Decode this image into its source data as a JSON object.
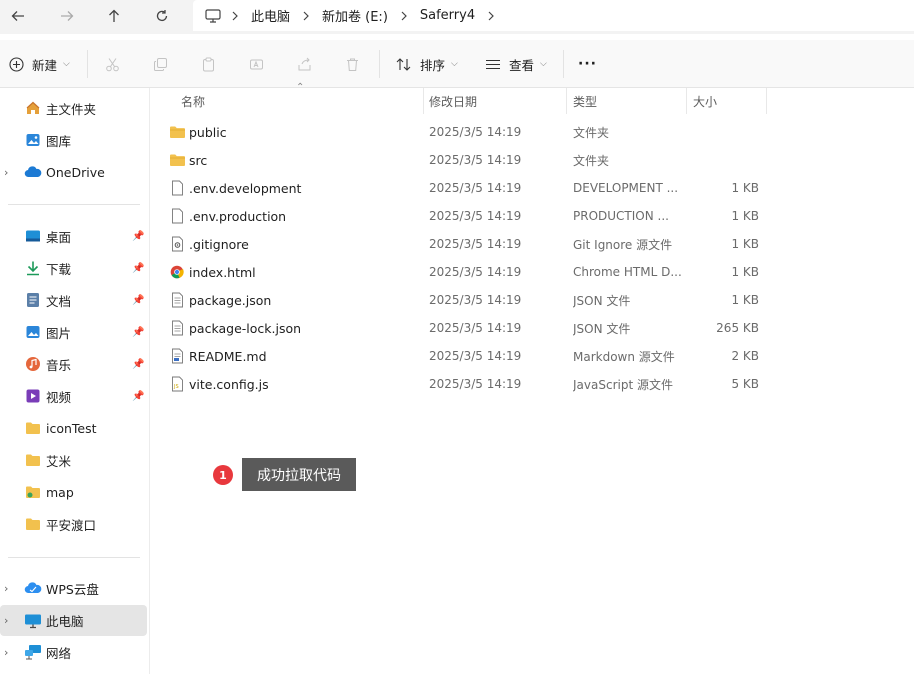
{
  "address": {
    "crumbs": [
      "此电脑",
      "新加卷 (E:)",
      "Saferry4"
    ]
  },
  "toolbar": {
    "new_label": "新建",
    "sort_label": "排序",
    "view_label": "查看",
    "more_label": "···"
  },
  "sidebar": {
    "top": [
      {
        "label": "主文件夹",
        "icon": "home-icon"
      },
      {
        "label": "图库",
        "icon": "gallery-icon"
      },
      {
        "label": "OneDrive",
        "icon": "onedrive-icon"
      }
    ],
    "quick": [
      {
        "label": "桌面",
        "icon": "desktop-icon"
      },
      {
        "label": "下载",
        "icon": "download-icon"
      },
      {
        "label": "文档",
        "icon": "documents-icon"
      },
      {
        "label": "图片",
        "icon": "pictures-icon"
      },
      {
        "label": "音乐",
        "icon": "music-icon"
      },
      {
        "label": "视频",
        "icon": "video-icon"
      },
      {
        "label": "iconTest",
        "icon": "folder-icon"
      },
      {
        "label": "艾米",
        "icon": "folder-icon"
      },
      {
        "label": "map",
        "icon": "folder-icon"
      },
      {
        "label": "平安渡口",
        "icon": "folder-icon"
      }
    ],
    "bottom": [
      {
        "label": "WPS云盘",
        "icon": "wps-cloud-icon"
      },
      {
        "label": "此电脑",
        "icon": "this-pc-icon"
      },
      {
        "label": "网络",
        "icon": "network-icon"
      }
    ]
  },
  "columns": {
    "name": "名称",
    "date": "修改日期",
    "type": "类型",
    "size": "大小"
  },
  "files": [
    {
      "name": "public",
      "date": "2025/3/5 14:19",
      "type": "文件夹",
      "size": "",
      "icon": "folder-icon"
    },
    {
      "name": "src",
      "date": "2025/3/5 14:19",
      "type": "文件夹",
      "size": "",
      "icon": "folder-icon"
    },
    {
      "name": ".env.development",
      "date": "2025/3/5 14:19",
      "type": "DEVELOPMENT ...",
      "size": "1 KB",
      "icon": "file-icon"
    },
    {
      "name": ".env.production",
      "date": "2025/3/5 14:19",
      "type": "PRODUCTION ...",
      "size": "1 KB",
      "icon": "file-icon"
    },
    {
      "name": ".gitignore",
      "date": "2025/3/5 14:19",
      "type": "Git Ignore 源文件",
      "size": "1 KB",
      "icon": "gear-file-icon"
    },
    {
      "name": "index.html",
      "date": "2025/3/5 14:19",
      "type": "Chrome HTML D...",
      "size": "1 KB",
      "icon": "chrome-icon"
    },
    {
      "name": "package.json",
      "date": "2025/3/5 14:19",
      "type": "JSON 文件",
      "size": "1 KB",
      "icon": "text-file-icon"
    },
    {
      "name": "package-lock.json",
      "date": "2025/3/5 14:19",
      "type": "JSON 文件",
      "size": "265 KB",
      "icon": "text-file-icon"
    },
    {
      "name": "README.md",
      "date": "2025/3/5 14:19",
      "type": "Markdown 源文件",
      "size": "2 KB",
      "icon": "markdown-icon"
    },
    {
      "name": "vite.config.js",
      "date": "2025/3/5 14:19",
      "type": "JavaScript 源文件",
      "size": "5 KB",
      "icon": "js-file-icon"
    }
  ],
  "annotation": {
    "number": "1",
    "text": "成功拉取代码"
  },
  "colors": {
    "folder": "#f2c14e",
    "badge": "#e8383d",
    "tooltip": "#5a5a5a",
    "selected": "#e5e5e5"
  }
}
